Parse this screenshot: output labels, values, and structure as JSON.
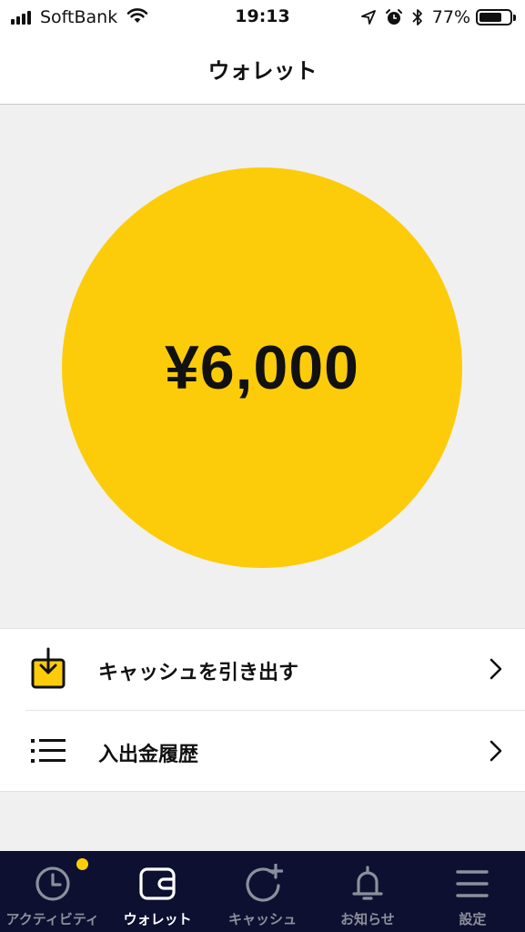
{
  "status_bar": {
    "carrier": "SoftBank",
    "time": "19:13",
    "battery_percent": "77%",
    "battery_level": 0.77,
    "icons": [
      "signal-icon",
      "wifi-icon",
      "location-arrow-icon",
      "alarm-icon",
      "bluetooth-icon",
      "battery-icon"
    ]
  },
  "header": {
    "title": "ウォレット"
  },
  "balance": {
    "amount": "¥6,000",
    "circle_color": "#fccc0a"
  },
  "menu": {
    "items": [
      {
        "label": "キャッシュを引き出す",
        "icon": "withdraw-icon"
      },
      {
        "label": "入出金履歴",
        "icon": "list-icon"
      }
    ]
  },
  "tab_bar": {
    "background": "#0d1030",
    "accent": "#fccc0a",
    "tabs": [
      {
        "label": "アクティビティ",
        "icon": "clock-icon",
        "active": false,
        "badge": true
      },
      {
        "label": "ウォレット",
        "icon": "wallet-icon",
        "active": true,
        "badge": false
      },
      {
        "label": "キャッシュ",
        "icon": "cash-add-icon",
        "active": false,
        "badge": false
      },
      {
        "label": "お知らせ",
        "icon": "bell-icon",
        "active": false,
        "badge": false
      },
      {
        "label": "設定",
        "icon": "menu-icon",
        "active": false,
        "badge": false
      }
    ]
  }
}
